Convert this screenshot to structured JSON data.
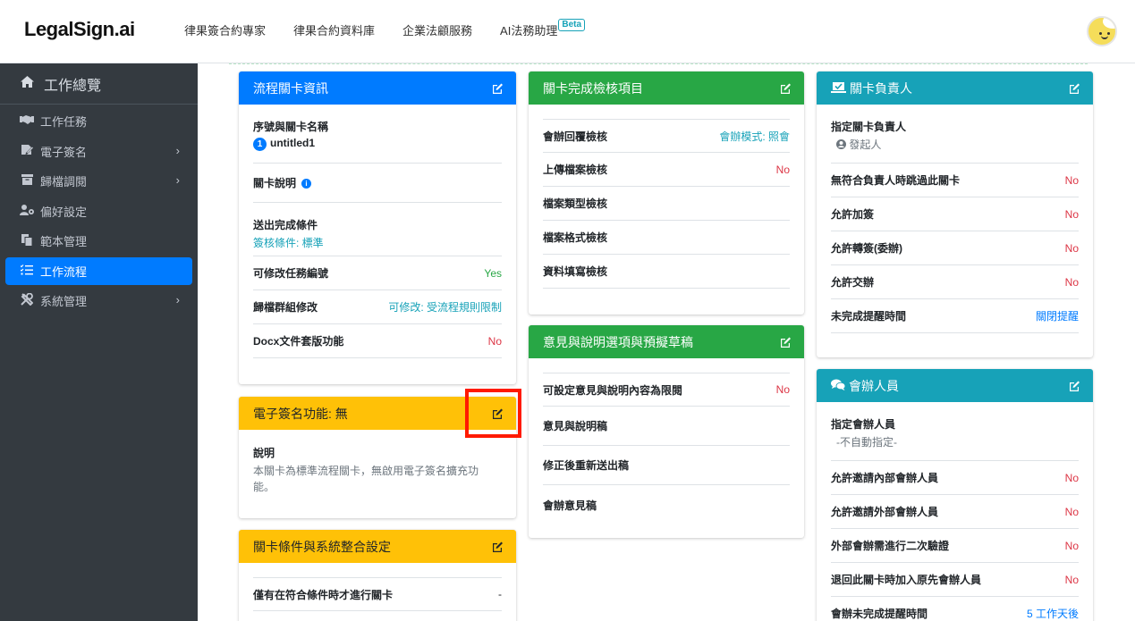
{
  "brand": {
    "logo": "LegalSign.ai"
  },
  "topnav": {
    "links": [
      "律果簽合約專家",
      "律果合約資料庫",
      "企業法顧服務",
      "AI法務助理"
    ],
    "beta": "Beta"
  },
  "sidebar": {
    "header": "工作總覽",
    "items": [
      {
        "label": "工作任務",
        "icon": "handshake-icon"
      },
      {
        "label": "電子簽名",
        "icon": "signature-icon",
        "chev": "›"
      },
      {
        "label": "歸檔調閱",
        "icon": "archive-icon",
        "chev": "›"
      },
      {
        "label": "偏好設定",
        "icon": "user-cog-icon"
      },
      {
        "label": "範本管理",
        "icon": "copy-icon"
      },
      {
        "label": "工作流程",
        "icon": "list-check-icon",
        "active": true
      },
      {
        "label": "系統管理",
        "icon": "tools-icon",
        "chev": "›"
      }
    ]
  },
  "cards": {
    "flow_info": {
      "title": "流程關卡資訊",
      "seq_label": "序號與關卡名稱",
      "seq_num": "1",
      "seq_name": "untitled1",
      "desc_label": "關卡說明",
      "info_glyph": "i",
      "submit_label": "送出完成條件",
      "submit_value": "簽核條件: 標準",
      "rows": [
        {
          "label": "可修改任務編號",
          "value": "Yes"
        },
        {
          "label": "歸檔群組修改",
          "value": "可修改: 受流程規則限制"
        },
        {
          "label": "Docx文件套版功能",
          "value": "No"
        }
      ]
    },
    "esign": {
      "title": "電子簽名功能: 無",
      "desc_label": "說明",
      "desc_text": "本關卡為標準流程關卡，無啟用電子簽名擴充功能。"
    },
    "condition": {
      "title": "關卡條件與系統整合設定",
      "row_label": "僅有在符合條件時才進行關卡",
      "row_value": "-"
    },
    "check": {
      "title": "關卡完成檢核項目",
      "rows": [
        {
          "label": "會辦回覆檢核",
          "value": "會辦模式: 照會"
        },
        {
          "label": "上傳檔案檢核",
          "value": "No"
        },
        {
          "label": "檔案類型檢核",
          "value": ""
        },
        {
          "label": "檔案格式檢核",
          "value": ""
        },
        {
          "label": "資料填寫檢核",
          "value": ""
        }
      ]
    },
    "opinion": {
      "title": "意見與說明選項與預擬草稿",
      "rows": [
        {
          "label": "可設定意見與說明內容為限閱",
          "value": "No"
        },
        {
          "label": "意見與說明稿",
          "value": ""
        },
        {
          "label": "修正後重新送出稿",
          "value": ""
        },
        {
          "label": "會辦意見稿",
          "value": ""
        }
      ]
    },
    "owner": {
      "title": "關卡負責人",
      "assign_label": "指定關卡負責人",
      "assign_value": "發起人",
      "rows": [
        {
          "label": "無符合負責人時跳過此關卡",
          "value": "No"
        },
        {
          "label": "允許加簽",
          "value": "No"
        },
        {
          "label": "允許轉簽(委辦)",
          "value": "No"
        },
        {
          "label": "允許交辦",
          "value": "No"
        },
        {
          "label": "未完成提醒時間",
          "value": "關閉提醒"
        }
      ]
    },
    "cosign": {
      "title": "會辦人員",
      "assign_label": "指定會辦人員",
      "assign_value": "-不自動指定-",
      "rows": [
        {
          "label": "允許邀請內部會辦人員",
          "value": "No"
        },
        {
          "label": "允許邀請外部會辦人員",
          "value": "No"
        },
        {
          "label": "外部會辦需進行二次驗證",
          "value": "No"
        },
        {
          "label": "退回此關卡時加入原先會辦人員",
          "value": "No"
        },
        {
          "label": "會辦未完成提醒時間",
          "value": "5 工作天後"
        }
      ]
    }
  }
}
